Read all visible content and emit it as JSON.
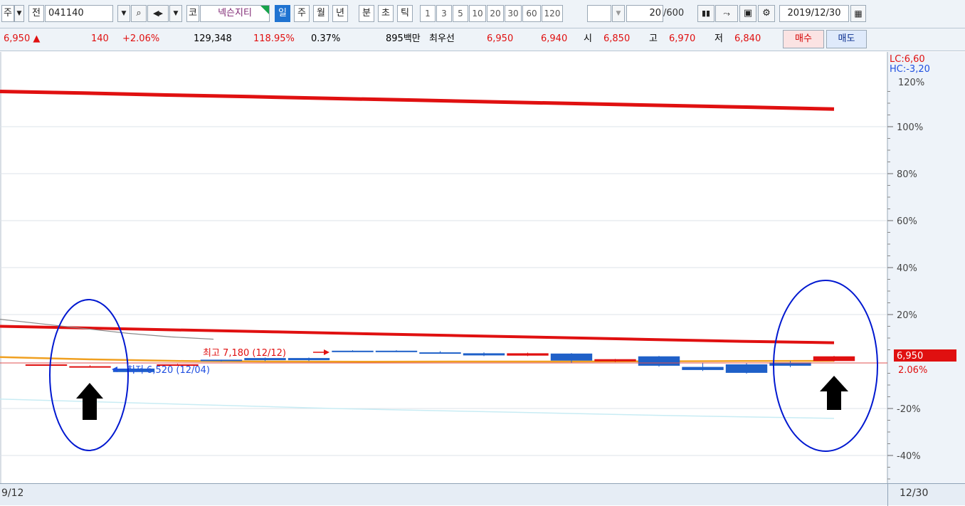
{
  "toolbar": {
    "market": "주",
    "prev": "전",
    "code": "041140",
    "market_tag": "코",
    "stock_name": "넥슨지티",
    "periods": [
      "일",
      "주",
      "월",
      "년",
      "분",
      "초",
      "틱"
    ],
    "intervals": [
      "1",
      "3",
      "5",
      "10",
      "20",
      "30",
      "60",
      "120"
    ],
    "count": "20",
    "count_max": "/600",
    "date": "2019/12/30"
  },
  "quote": {
    "price": "6,950",
    "change": "140",
    "change_pct": "+2.06%",
    "volume": "129,348",
    "volume_ratio": "118.95%",
    "turnover": "0.37%",
    "amount": "895백만",
    "bid_label": "최우선",
    "ask": "6,950",
    "bid": "6,940",
    "open_label": "시",
    "open": "6,850",
    "high_label": "고",
    "high": "6,970",
    "low_label": "저",
    "low": "6,840",
    "buy_label": "매수",
    "sell_label": "매도"
  },
  "chart_data": {
    "type": "candlestick",
    "y_unit": "%",
    "yaxis_ticks": [
      "100%",
      "80%",
      "60%",
      "40%",
      "20%",
      "-20%",
      "-40%"
    ],
    "yaxis_top_partial": "120%",
    "legend": {
      "lc": "LC:6,60",
      "hc": "HC:-3,20"
    },
    "current_price_label": "6,950",
    "current_change_label": "2.06%",
    "high_annotation": "최고 7,180 (12/12)",
    "low_annotation": "최저 6,520 (12/04)",
    "x_start_label": "9/12",
    "x_end_label": "12/30",
    "candles": [
      {
        "o": -1.2,
        "c": -1.2,
        "h": -1.2,
        "l": -1.2
      },
      {
        "o": -2.0,
        "c": -2.0,
        "h": -1.6,
        "l": -2.4
      },
      {
        "o": -3.0,
        "c": -4.5,
        "h": -2.5,
        "l": -5.0
      },
      {
        "o": -1.5,
        "c": -1.2,
        "h": -1.0,
        "l": -1.5
      },
      {
        "o": 0.8,
        "c": 0.4,
        "h": 0.8,
        "l": 0.0
      },
      {
        "o": 1.5,
        "c": 0.6,
        "h": 1.7,
        "l": 0.2
      },
      {
        "o": 1.5,
        "c": 0.6,
        "h": 1.7,
        "l": 0.2
      },
      {
        "o": 4.6,
        "c": 4.3,
        "h": 4.8,
        "l": 4.2
      },
      {
        "o": 4.6,
        "c": 4.3,
        "h": 4.8,
        "l": 4.2
      },
      {
        "o": 3.9,
        "c": 3.7,
        "h": 4.4,
        "l": 3.5
      },
      {
        "o": 3.5,
        "c": 2.6,
        "h": 3.9,
        "l": 2.3
      },
      {
        "o": 2.5,
        "c": 3.5,
        "h": 3.8,
        "l": 2.3
      },
      {
        "o": 3.4,
        "c": 0.4,
        "h": 3.6,
        "l": -0.6
      },
      {
        "o": 0.1,
        "c": 1.0,
        "h": 1.1,
        "l": -0.2
      },
      {
        "o": 2.2,
        "c": -1.8,
        "h": 2.4,
        "l": -2.2
      },
      {
        "o": -2.3,
        "c": -3.6,
        "h": -0.4,
        "l": -4.0
      },
      {
        "o": -1.2,
        "c": -4.8,
        "h": -0.6,
        "l": -5.2
      },
      {
        "o": -0.4,
        "c": -1.8,
        "h": 0.2,
        "l": -2.4
      },
      {
        "o": 0.2,
        "c": 2.2,
        "h": 2.4,
        "l": 0.0
      }
    ],
    "series": [
      {
        "color": "#e01010",
        "values": [
          115.0,
          114.3,
          113.5,
          112.8,
          112.0,
          111.3,
          110.5,
          109.8,
          109.0,
          108.3,
          107.5
        ]
      },
      {
        "color": "#e01010",
        "values": [
          15.0,
          14.2,
          13.4,
          12.6,
          11.8,
          11.0,
          10.2,
          9.4,
          8.6,
          8.0
        ]
      },
      {
        "color": "#f0a020",
        "values": [
          1.9,
          0.9,
          0.2,
          0.0,
          -0.1,
          0.0,
          0.0,
          0.1,
          0.2,
          0.3
        ]
      },
      {
        "color": "#8a8a8a",
        "values": [
          18.0,
          16.0,
          14.0,
          12.0,
          10.5,
          9.5
        ]
      },
      {
        "color": "#c8ecf4",
        "values": [
          -16.0,
          -18.0,
          -20.0,
          -21.5,
          -23.0,
          -24.2
        ]
      }
    ],
    "annotations": {
      "circle_color": "#0018d0",
      "arrow_color": "#000000"
    }
  }
}
